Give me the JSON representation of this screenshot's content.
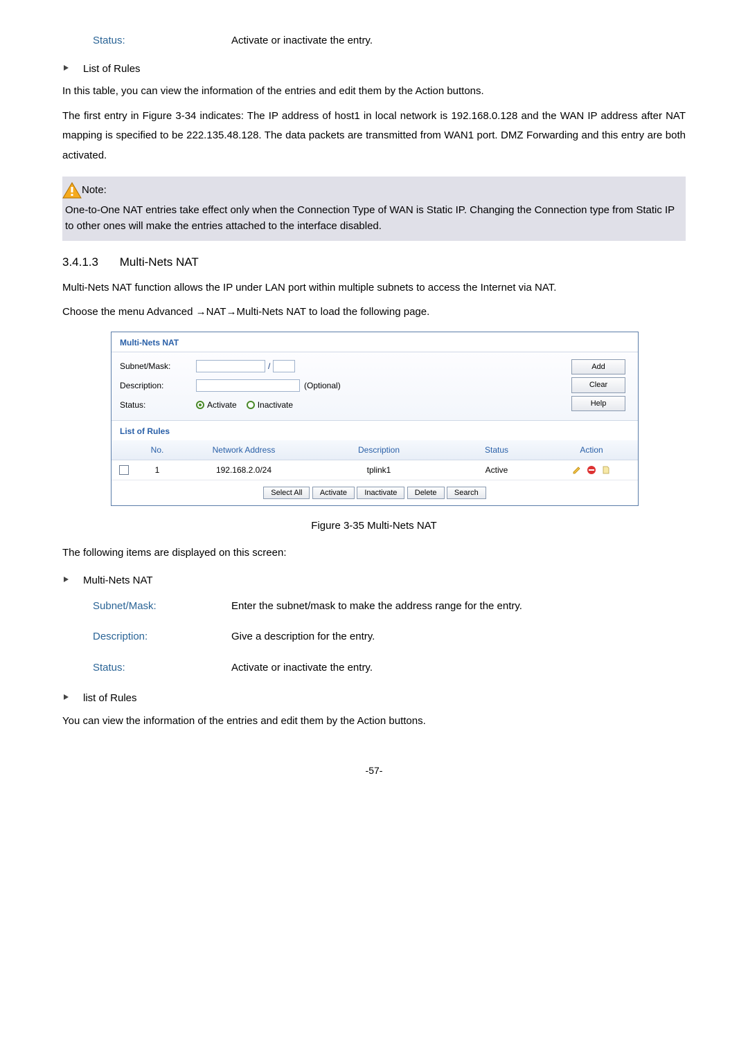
{
  "top_field": {
    "label": "Status:",
    "value": "Activate or inactivate the entry."
  },
  "list_of_rules_heading": "List of Rules",
  "para1": "In this table, you can view the information of the entries and edit them by the Action buttons.",
  "para2": "The first entry in Figure 3-34 indicates: The IP address of host1 in local network is 192.168.0.128 and the WAN IP address after NAT mapping is specified to be 222.135.48.128. The data packets are transmitted from WAN1 port. DMZ Forwarding and this entry are both activated.",
  "note_label": "Note:",
  "note_body": "One-to-One NAT entries take effect only when the Connection Type of WAN is Static IP. Changing the Connection type from Static IP to other ones will make the entries attached to the interface disabled.",
  "h3_num": "3.4.1.3",
  "h3_title": "Multi-Nets NAT",
  "para3": "Multi-Nets NAT function allows the IP under LAN port within multiple subnets to access the Internet via NAT.",
  "para4": "Choose the menu Advanced →NAT→Multi-Nets NAT   to load the following page.",
  "screenshot": {
    "section1_title": "Multi-Nets NAT",
    "form": {
      "subnet_label": "Subnet/Mask:",
      "slash": "/",
      "desc_label": "Description:",
      "desc_hint": "(Optional)",
      "status_label": "Status:",
      "activate_label": "Activate",
      "inactivate_label": "Inactivate"
    },
    "side_buttons": {
      "add": "Add",
      "clear": "Clear",
      "help": "Help"
    },
    "section2_title": "List of Rules",
    "table": {
      "headers": {
        "no": "No.",
        "net": "Network Address",
        "desc": "Description",
        "status": "Status",
        "action": "Action"
      },
      "row1": {
        "no": "1",
        "net": "192.168.2.0/24",
        "desc": "tplink1",
        "status": "Active"
      }
    },
    "footer_buttons": {
      "select_all": "Select All",
      "activate": "Activate",
      "inactivate": "Inactivate",
      "delete": "Delete",
      "search": "Search"
    }
  },
  "caption": "Figure 3-35 Multi-Nets NAT",
  "para5": "The following items are displayed on this screen:",
  "section_mn_title": "Multi-Nets NAT",
  "fields": {
    "subnet": {
      "label": "Subnet/Mask:",
      "value": "Enter the subnet/mask to make the address range for the entry."
    },
    "desc": {
      "label": "Description:",
      "value": "Give a description for the entry."
    },
    "status": {
      "label": "Status:",
      "value": "Activate or inactivate the entry."
    }
  },
  "list_rules2": "list of Rules",
  "para6": "You can view the information of the entries and edit them by the Action buttons.",
  "page_number": "-57-"
}
